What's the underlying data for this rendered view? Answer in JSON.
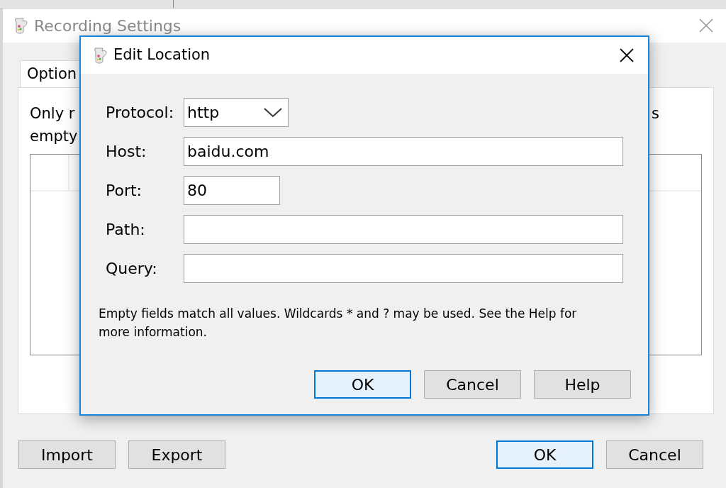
{
  "main_window": {
    "title": "Recording Settings",
    "tab": {
      "label": "Option",
      "selected": true
    },
    "text_lines": [
      "Only r",
      "empty"
    ],
    "text_right": "s",
    "buttons_left": [
      {
        "label": "Import",
        "default": false
      },
      {
        "label": "Export",
        "default": false
      }
    ],
    "buttons_right": [
      {
        "label": "OK",
        "default": true
      },
      {
        "label": "Cancel",
        "default": false
      }
    ]
  },
  "dialog": {
    "title": "Edit Location",
    "fields": [
      {
        "kind": "select",
        "label": "Protocol:",
        "value": "http"
      },
      {
        "kind": "wide",
        "label": "Host:",
        "value": "baidu.com"
      },
      {
        "kind": "narrow",
        "label": "Port:",
        "value": "80"
      },
      {
        "kind": "wide",
        "label": "Path:"
      },
      {
        "kind": "wide",
        "label": "Query:"
      }
    ],
    "note": "Empty fields match all values. Wildcards * and ? may be used. See the Help for more information.",
    "buttons": [
      {
        "label": "OK",
        "default": true
      },
      {
        "label": "Cancel",
        "default": false
      },
      {
        "label": "Help",
        "default": false
      }
    ]
  }
}
